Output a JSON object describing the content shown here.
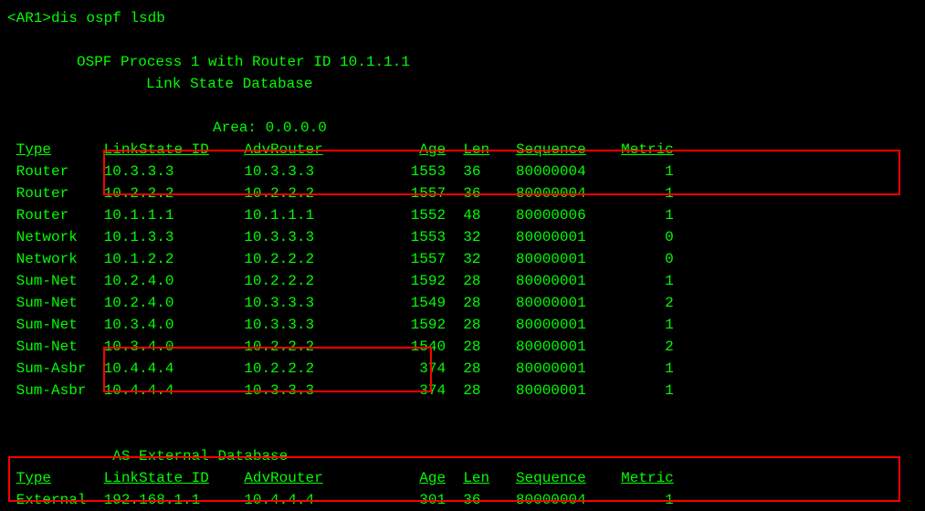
{
  "prompt": "<AR1>",
  "command": "dis ospf lsdb",
  "header_line1": "OSPF Process 1 with Router ID 10.1.1.1",
  "header_line2": "Link State Database",
  "area_label": "Area: 0.0.0.0",
  "columns": {
    "c1": "Type",
    "c2": "LinkState ID",
    "c3": "AdvRouter",
    "c4": "Age",
    "c5": "Len",
    "c6": "Sequence",
    "c7": "Metric"
  },
  "rows": [
    {
      "type": "Router",
      "lsid": "10.3.3.3",
      "adv": "10.3.3.3",
      "age": "1553",
      "len": "36",
      "seq": "80000004",
      "metric": "1"
    },
    {
      "type": "Router",
      "lsid": "10.2.2.2",
      "adv": "10.2.2.2",
      "age": "1557",
      "len": "36",
      "seq": "80000004",
      "metric": "1"
    },
    {
      "type": "Router",
      "lsid": "10.1.1.1",
      "adv": "10.1.1.1",
      "age": "1552",
      "len": "48",
      "seq": "80000006",
      "metric": "1"
    },
    {
      "type": "Network",
      "lsid": "10.1.3.3",
      "adv": "10.3.3.3",
      "age": "1553",
      "len": "32",
      "seq": "80000001",
      "metric": "0"
    },
    {
      "type": "Network",
      "lsid": "10.1.2.2",
      "adv": "10.2.2.2",
      "age": "1557",
      "len": "32",
      "seq": "80000001",
      "metric": "0"
    },
    {
      "type": "Sum-Net",
      "lsid": "10.2.4.0",
      "adv": "10.2.2.2",
      "age": "1592",
      "len": "28",
      "seq": "80000001",
      "metric": "1"
    },
    {
      "type": "Sum-Net",
      "lsid": "10.2.4.0",
      "adv": "10.3.3.3",
      "age": "1549",
      "len": "28",
      "seq": "80000001",
      "metric": "2"
    },
    {
      "type": "Sum-Net",
      "lsid": "10.3.4.0",
      "adv": "10.3.3.3",
      "age": "1592",
      "len": "28",
      "seq": "80000001",
      "metric": "1"
    },
    {
      "type": "Sum-Net",
      "lsid": "10.3.4.0",
      "adv": "10.2.2.2",
      "age": "1540",
      "len": "28",
      "seq": "80000001",
      "metric": "2"
    },
    {
      "type": "Sum-Asbr",
      "lsid": "10.4.4.4",
      "adv": "10.2.2.2",
      "age": "374",
      "len": "28",
      "seq": "80000001",
      "metric": "1"
    },
    {
      "type": "Sum-Asbr",
      "lsid": "10.4.4.4",
      "adv": "10.3.3.3",
      "age": "374",
      "len": "28",
      "seq": "80000001",
      "metric": "1"
    }
  ],
  "ext_header": "AS External Database",
  "ext_columns": {
    "c1": "Type",
    "c2": "LinkState ID",
    "c3": "AdvRouter",
    "c4": "Age",
    "c5": "Len",
    "c6": "Sequence",
    "c7": "Metric"
  },
  "ext_rows": [
    {
      "type": "External",
      "lsid": "192.168.1.1",
      "adv": "10.4.4.4",
      "age": "301",
      "len": "36",
      "seq": "80000004",
      "metric": "1"
    }
  ]
}
